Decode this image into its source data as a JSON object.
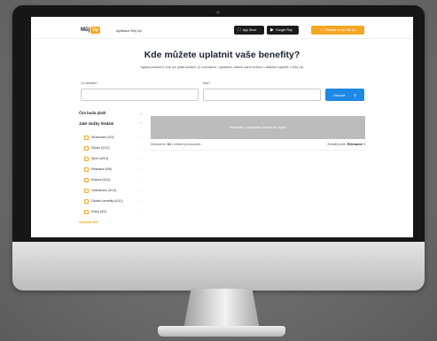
{
  "nav": {
    "logo_text": "Můj",
    "logo_badge": "Up",
    "link": "Aplikace Můj Up",
    "app_store": "App Store",
    "google_play": "Google Play",
    "login": "Přihlásit se do Můj Up"
  },
  "hero": {
    "title": "Kde můžete uplatnit vaše benefity?",
    "subtitle": "Vyjaka partnerů, kde lze platit kartami, je orientační. Uplatnění vašich karet ovšem v dalšího najdete v Můj Up."
  },
  "search": {
    "what_label": "Co hledáte?",
    "where_label": "Kde?",
    "what_placeholder": "",
    "where_placeholder": "",
    "button_label": "Vstoutě"
  },
  "filters": {
    "payment_heading": "Čím budu platit",
    "services_heading": "Jaké služby hledám",
    "items": [
      {
        "label": "Stravování (0/3)"
      },
      {
        "label": "Zdraví (0/12)"
      },
      {
        "label": "Sport (0/14)"
      },
      {
        "label": "Relaxace (0/8)"
      },
      {
        "label": "Kultura (0/11)"
      },
      {
        "label": "Vzdělávání (0/13)"
      },
      {
        "label": "Ostatní benefity (0/12)"
      },
      {
        "label": "Knihy (0/2)"
      }
    ],
    "reset_label": "Vymazat filtr"
  },
  "map": {
    "notice": "Klikneatie odcinejata hledání na mapě"
  },
  "results": {
    "prefix": "Zobrazeno:",
    "count": "10",
    "suffix": "z celkem provozoven",
    "sort_label": "Seřadit podle:",
    "sort_value": "Relevance"
  },
  "colors": {
    "brand": "#f5a623",
    "primary": "#1e88e5",
    "map_placeholder": "#bcbcbc"
  },
  "icons": [
    "apple-icon",
    "play-icon",
    "user-icon",
    "search-icon",
    "chevron-down-icon"
  ]
}
